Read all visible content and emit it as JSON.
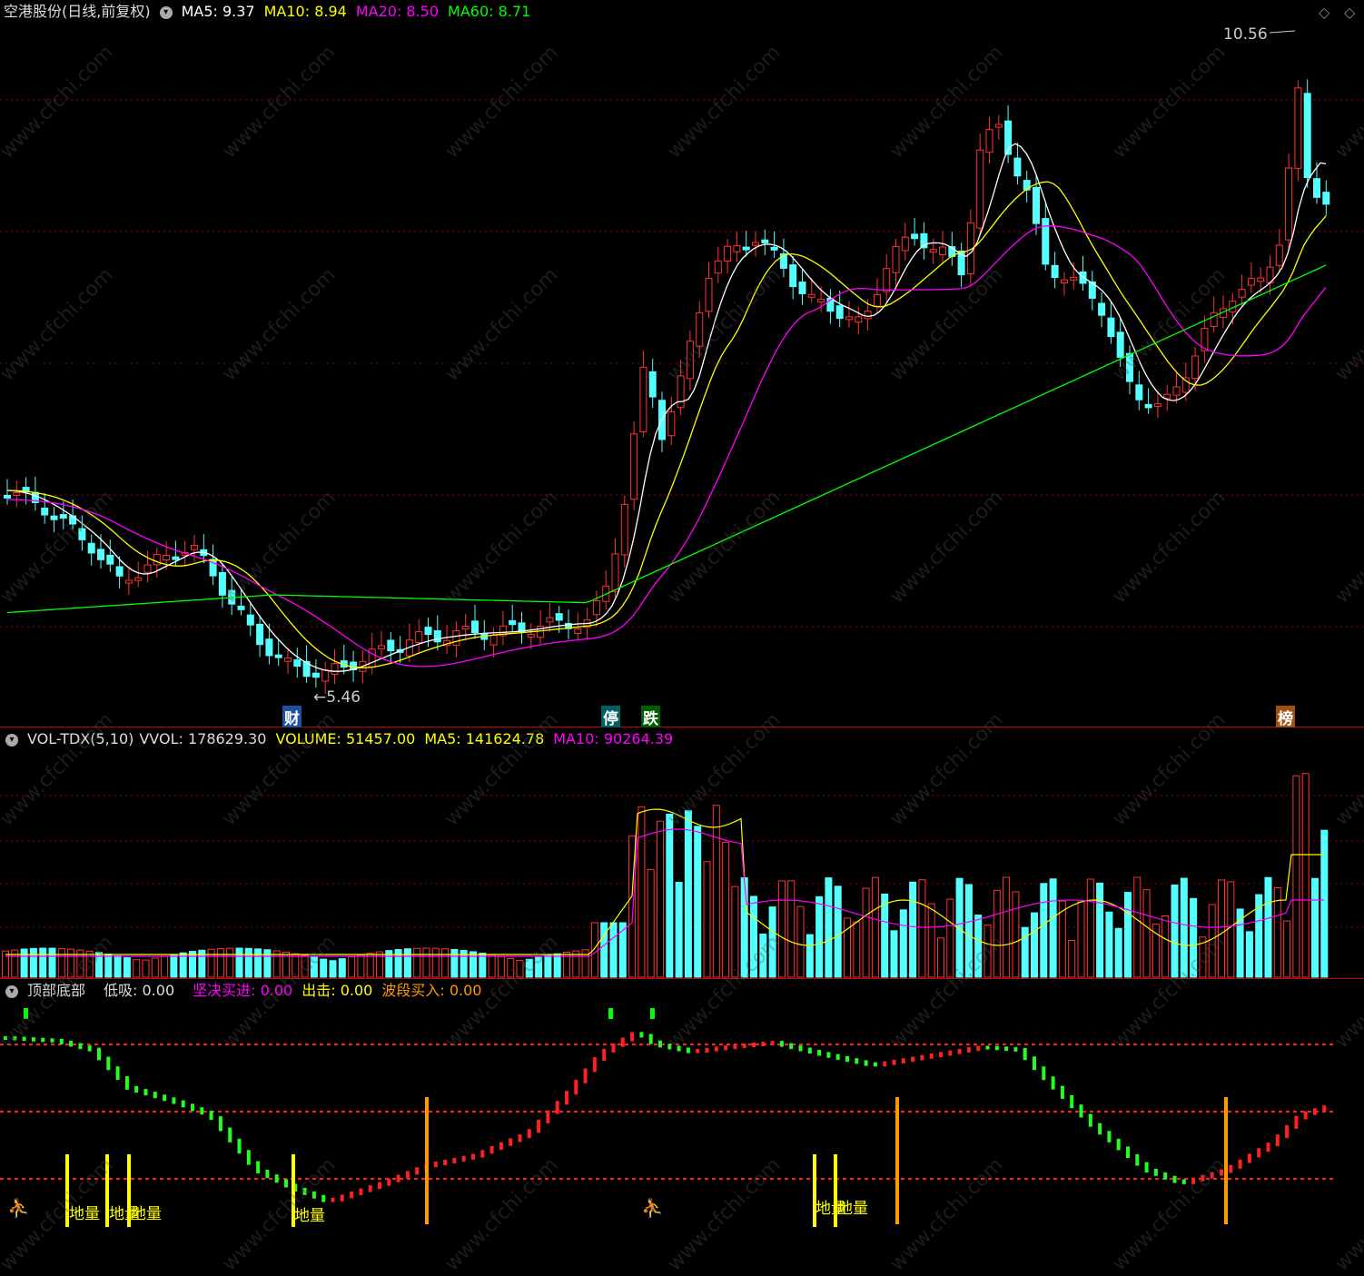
{
  "main_chart": {
    "title": "空港股份(日线,前复权)",
    "ma5": "MA5: 9.37",
    "ma10": "MA10: 8.94",
    "ma20": "MA20: 8.50",
    "ma60": "MA60: 8.71",
    "high_label": "10.56",
    "low_label": "5.46",
    "markers": {
      "cai": "财",
      "ting": "停",
      "die": "跌",
      "bang": "榜"
    }
  },
  "volume_chart": {
    "name": "VOL-TDX(5,10)",
    "vvol": "VVOL: 178629.30",
    "volume": "VOLUME: 51457.00",
    "ma5": "MA5: 141624.78",
    "ma10": "MA10: 90264.39"
  },
  "indicator_chart": {
    "name": "顶部底部",
    "dixi": "低吸: 0.00",
    "jianjue": "坚决买进: 0.00",
    "chuji": "出击: 0.00",
    "boduan": "波段买入: 0.00",
    "signal_labels": [
      "地量",
      "地量",
      "地量",
      "地量",
      "地量",
      "地量"
    ]
  },
  "colors": {
    "up": "#ff3232",
    "down": "#54ffff",
    "ma5": "#ffffff",
    "ma10": "#ffff00",
    "ma20": "#ff00ff",
    "ma60": "#00ff00",
    "grid": "#8b0000"
  },
  "watermark": "www.cfchi.com"
}
